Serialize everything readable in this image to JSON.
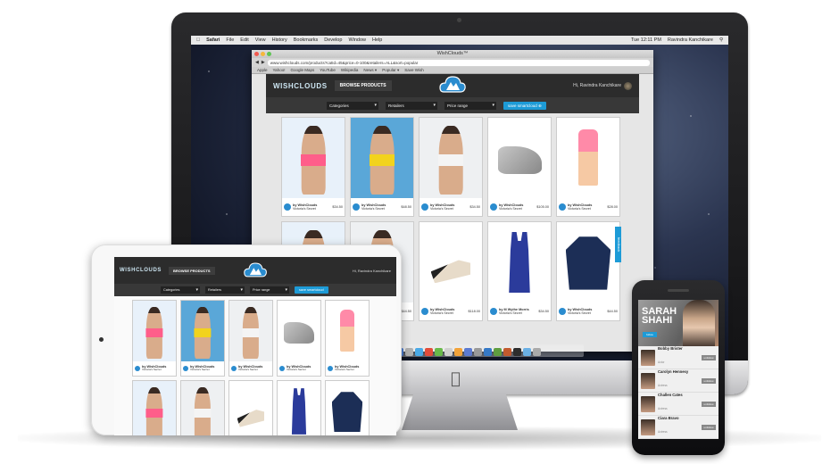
{
  "imac": {
    "menubar": {
      "app": "Safari",
      "items": [
        "File",
        "Edit",
        "View",
        "History",
        "Bookmarks",
        "Develop",
        "Window",
        "Help"
      ],
      "clock": "Tue 12:11 PM",
      "user": "Ravindra Kanchikare"
    },
    "safari": {
      "title": "WishClouds™",
      "address": "www.wishclouds.com/products?catId=45&price=0-100&retailers=ALL&sort=popular",
      "bookmarks": [
        "Apple",
        "Yahoo!",
        "Google Maps",
        "YouTube",
        "Wikipedia",
        "News ▾",
        "Popular ▾",
        "Save Wish"
      ]
    },
    "site": {
      "logo": "WISHCLOUDS",
      "browse_label": "BROWSE PRODUCTS",
      "greeting": "Hi, Ravindra Kanchikare",
      "filters": [
        "Categories",
        "Retailers",
        "Price range"
      ],
      "save_button": "save smartcloud",
      "feedback": "feedback"
    },
    "products": [
      {
        "by": "by WishClouds",
        "retailer": "Victoria's Secret",
        "price": "$34.50",
        "kind": "model-pink"
      },
      {
        "by": "by WishClouds",
        "retailer": "Victoria's Secret",
        "price": "$48.50",
        "kind": "model-yellow"
      },
      {
        "by": "by WishClouds",
        "retailer": "Victoria's Secret",
        "price": "$34.50",
        "kind": "model-white"
      },
      {
        "by": "by WishClouds",
        "retailer": "Victoria's Secret",
        "price": "$105.00",
        "kind": "shoe"
      },
      {
        "by": "by WishClouds",
        "retailer": "Victoria's Secret",
        "price": "$28.00",
        "kind": "tube"
      }
    ],
    "products_row2": [
      {
        "by": "",
        "retailer": "",
        "price": "",
        "kind": "model-pink"
      },
      {
        "by": "",
        "retailer": "",
        "price": "$44.50",
        "kind": "model-white"
      },
      {
        "by": "by WishClouds",
        "retailer": "Victoria's Secret",
        "price": "$118.00",
        "kind": "heels"
      },
      {
        "by": "by M Wythe Morris",
        "retailer": "Victoria's Secret",
        "price": "$34.50",
        "kind": "tank"
      },
      {
        "by": "by WishClouds",
        "retailer": "Victoria's Secret",
        "price": "$44.50",
        "kind": "hoodie"
      }
    ]
  },
  "ipad": {
    "logo": "WISHCLOUDS",
    "browse_label": "BROWSE PRODUCTS",
    "greeting": "Hi, Ravindra Kanchikare",
    "filters": [
      "Categories",
      "Retailers",
      "Price range"
    ],
    "save_button": "save smartcloud",
    "products": [
      {
        "by": "by WishClouds",
        "retailer": "Victoria's Secret",
        "price": "",
        "kind": "model-pink"
      },
      {
        "by": "by WishClouds",
        "retailer": "Victoria's Secret",
        "price": "",
        "kind": "model-yellow"
      },
      {
        "by": "by WishClouds",
        "retailer": "Victoria's Secret",
        "price": "",
        "kind": "model-white"
      },
      {
        "by": "by WishClouds",
        "retailer": "Victoria's Secret",
        "price": "",
        "kind": "shoe"
      },
      {
        "by": "by WishClouds",
        "retailer": "Victoria's Secret",
        "price": "",
        "kind": "tube"
      }
    ],
    "products_row2": [
      {
        "kind": "model-pink"
      },
      {
        "kind": "model-white"
      },
      {
        "kind": "heels"
      },
      {
        "kind": "tank"
      },
      {
        "kind": "hoodie"
      }
    ]
  },
  "iphone": {
    "hero_name_line1": "SARAH",
    "hero_name_line2": "SHAHI",
    "hero_follow": "follow",
    "celebs": [
      {
        "name": "Bobby Brister",
        "sub": "Actor",
        "action": "unfollow"
      },
      {
        "name": "Carolyn Hennesy",
        "sub": "Actress",
        "action": "unfollow"
      },
      {
        "name": "Challen Cates",
        "sub": "Actress",
        "action": "unfollow"
      },
      {
        "name": "Ciara Bravo",
        "sub": "Actress",
        "action": "unfollow"
      }
    ]
  },
  "colors": {
    "accent": "#1d9bd7",
    "header_dark": "#2c2c2c",
    "filter_bar": "#383838"
  }
}
